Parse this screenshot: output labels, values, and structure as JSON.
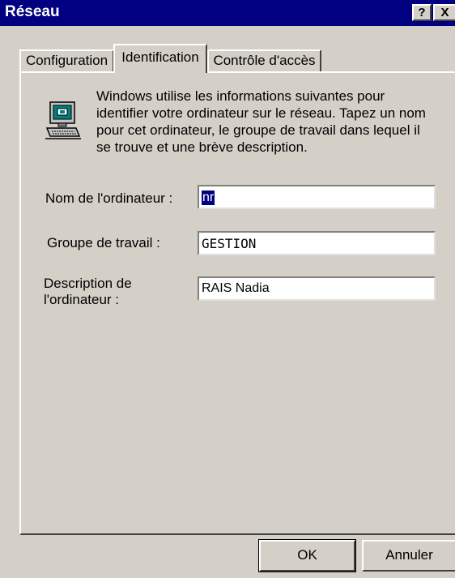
{
  "window": {
    "title": "Réseau",
    "help_button": "?",
    "close_button": "X"
  },
  "tabs": [
    {
      "label": "Configuration",
      "selected": false
    },
    {
      "label": "Identification",
      "selected": true
    },
    {
      "label": "Contrôle d'accès",
      "selected": false
    }
  ],
  "panel": {
    "icon": "networked-computer-icon",
    "intro": "Windows utilise les informations suivantes pour identifier votre ordinateur sur le réseau. Tapez un nom pour cet ordinateur, le groupe de travail dans lequel il se trouve et une brève description."
  },
  "fields": {
    "computer_name": {
      "label": "Nom de l'ordinateur :",
      "value": "nr",
      "selected": true
    },
    "workgroup": {
      "label": "Groupe de travail :",
      "value": "GESTION"
    },
    "description": {
      "label": "Description de l'ordinateur :",
      "value": "RAIS Nadia"
    }
  },
  "buttons": {
    "ok": "OK",
    "cancel": "Annuler"
  },
  "colors": {
    "title_bar": "#000080",
    "face": "#d4d0c8",
    "selection": "#000080"
  }
}
